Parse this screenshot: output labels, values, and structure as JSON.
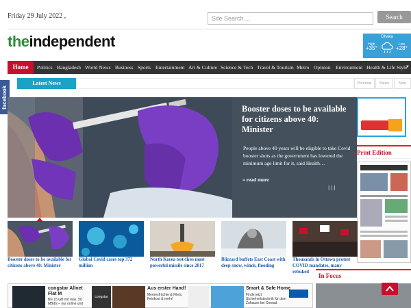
{
  "header": {
    "date": "Friday 29 July 2022 ,",
    "search_placeholder": "Site Search....",
    "search_button": "Search"
  },
  "logo": {
    "part1": "the",
    "part2": "independent"
  },
  "weather": {
    "city": "Dhaka",
    "high_label": "High",
    "high_value": "+35°",
    "low_label": "Low",
    "low_value": "+28°",
    "icon": "cloud-rain-icon"
  },
  "nav": {
    "home": "Home",
    "items": [
      "Politics",
      "Bangladesh",
      "World News",
      "Business",
      "Sports",
      "Entertainment",
      "Art & Culture",
      "Science & Tech",
      "Travel & Tourism",
      "Metro",
      "Opinion",
      "Environment",
      "Health & Life Style"
    ]
  },
  "latest": {
    "label": "Latest News",
    "controls": [
      "Previous",
      "Pause",
      "Next"
    ]
  },
  "social": {
    "facebook": "facebook"
  },
  "hero": {
    "title": "Booster doses to be available for citizens above 40: Minister",
    "description": "People above 40 years will be eligible to take Covid booster shots as the government has lowered the minimum age limit for it, said Health…",
    "read_more": "» read more",
    "arrows": "ǀǀǀ"
  },
  "sidebar": {
    "print_edition": "Print Edition",
    "in_focus": "In Focus"
  },
  "thumbs": [
    {
      "caption": "Booster doses to be available for citizens above 40: Minister"
    },
    {
      "caption": "Global Covid cases top 372 million"
    },
    {
      "caption": "North Korea test-fires most powerful missile since 2017"
    },
    {
      "caption": "Blizzard buffets East Coast with deep snow, winds, flooding"
    },
    {
      "caption": "Thousands in Ottawa protest COVID mandates, many rebuked"
    }
  ],
  "ads": {
    "ad1_title": "congstar Allnet Flat M",
    "ad1_text": "Bis 15 GB mit max. 50 MBit/s – nur online und",
    "ad2_brand": "congstar",
    "ad3_title": "Aus erster Hand!",
    "ad3_text": "Meeresfrüchte & Filets, Feinkost & mehr!",
    "ad4_title": "Smart & Safe Home",
    "ad4_text": "Finde jetzt Sicherheitstechnik für dein Zuhause bei Conrad"
  },
  "colors": {
    "accent": "#c8102e",
    "nav": "#333333",
    "latest": "#1aa3c4",
    "weather": "#3aa0d8",
    "facebook": "#3b5998",
    "link": "#1a5aa6"
  }
}
